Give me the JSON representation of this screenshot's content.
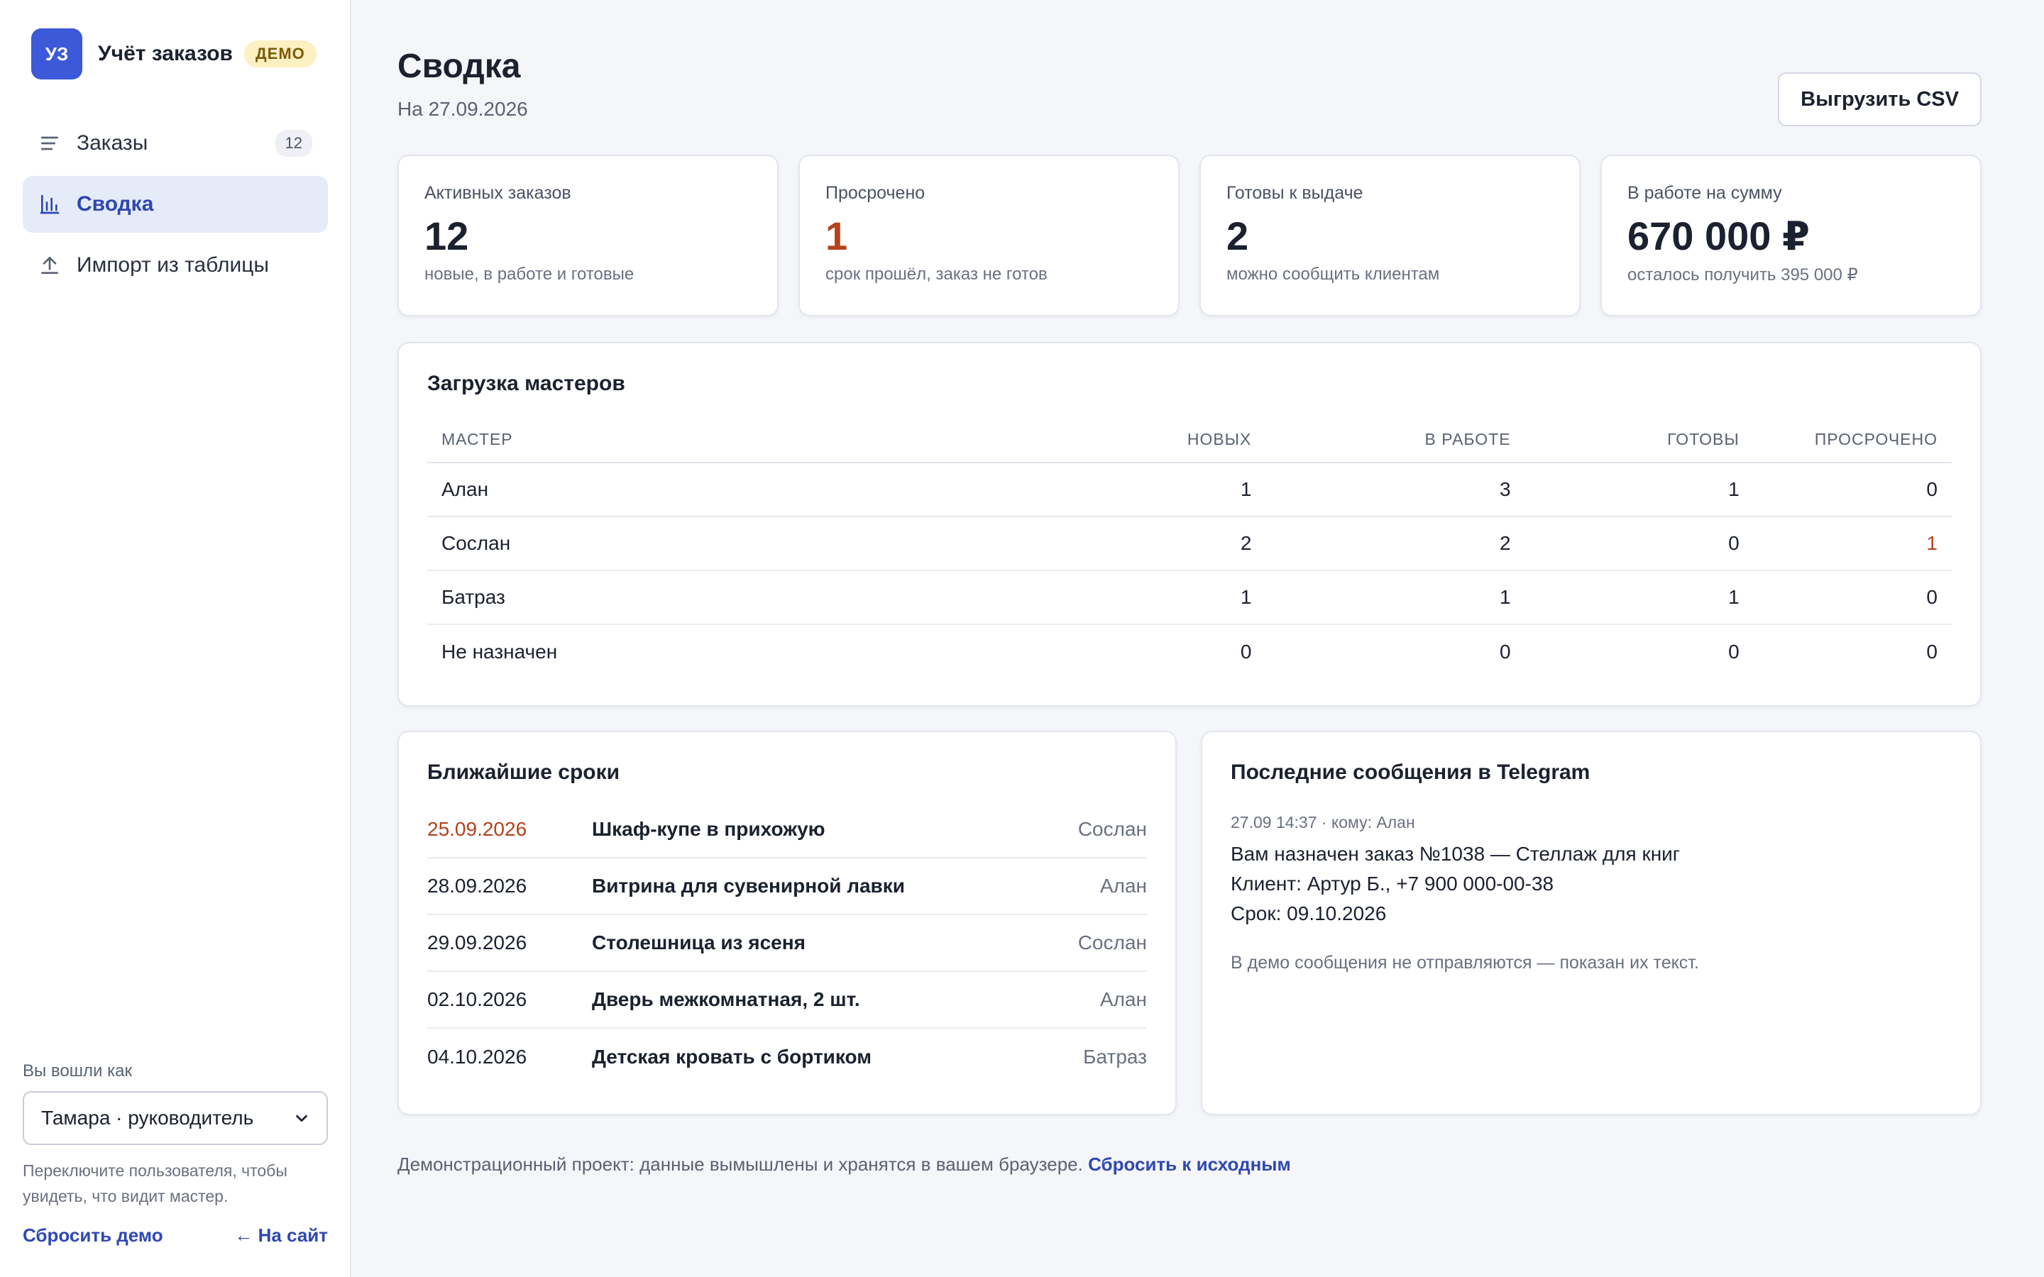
{
  "brand": {
    "logo": "УЗ",
    "name": "Учёт заказов",
    "badge": "ДЕМО"
  },
  "sidebar": {
    "items": [
      {
        "label": "Заказы",
        "icon": "list-icon",
        "count": "12"
      },
      {
        "label": "Сводка",
        "icon": "bar-chart-icon",
        "active": true
      },
      {
        "label": "Импорт из таблицы",
        "icon": "upload-icon"
      }
    ],
    "user_label": "Вы вошли как",
    "user_value": "Тамара · руководитель",
    "user_hint": "Переключите пользователя, чтобы увидеть, что видит мастер.",
    "reset_demo": "Сбросить демо",
    "to_site": "← На сайт"
  },
  "header": {
    "title": "Сводка",
    "date": "На 27.09.2026",
    "export_label": "Выгрузить CSV"
  },
  "stats": [
    {
      "label": "Активных заказов",
      "value": "12",
      "sub": "новые, в работе и готовые"
    },
    {
      "label": "Просрочено",
      "value": "1",
      "sub": "срок прошёл, заказ не готов",
      "warn": true
    },
    {
      "label": "Готовы к выдаче",
      "value": "2",
      "sub": "можно сообщить клиентам"
    },
    {
      "label": "В работе на сумму",
      "value": "670 000 ₽",
      "sub": "осталось получить 395 000 ₽"
    }
  ],
  "masters": {
    "title": "Загрузка мастеров",
    "columns": [
      "МАСТЕР",
      "НОВЫХ",
      "В РАБОТЕ",
      "ГОТОВЫ",
      "ПРОСРОЧЕНО"
    ],
    "rows": [
      [
        "Алан",
        "1",
        "3",
        "1",
        "0"
      ],
      [
        "Сослан",
        "2",
        "2",
        "0",
        "1"
      ],
      [
        "Батраз",
        "1",
        "1",
        "1",
        "0"
      ],
      [
        "Не назначен",
        "0",
        "0",
        "0",
        "0"
      ]
    ]
  },
  "deadlines": {
    "title": "Ближайшие сроки",
    "items": [
      {
        "date": "25.09.2026",
        "name": "Шкаф-купе в прихожую",
        "master": "Сослан",
        "overdue": true
      },
      {
        "date": "28.09.2026",
        "name": "Витрина для сувенирной лавки",
        "master": "Алан"
      },
      {
        "date": "29.09.2026",
        "name": "Столешница из ясеня",
        "master": "Сослан"
      },
      {
        "date": "02.10.2026",
        "name": "Дверь межкомнатная, 2 шт.",
        "master": "Алан"
      },
      {
        "date": "04.10.2026",
        "name": "Детская кровать с бортиком",
        "master": "Батраз"
      }
    ]
  },
  "telegram": {
    "title": "Последние сообщения в Telegram",
    "meta": "27.09 14:37 · кому: Алан",
    "lines": [
      "Вам назначен заказ №1038 — Стеллаж для книг",
      "Клиент: Артур Б., +7 900 000-00-38",
      "Срок: 09.10.2026"
    ],
    "note": "В демо сообщения не отправляются — показан их текст."
  },
  "footer": {
    "text": "Демонстрационный проект: данные вымышлены и хранятся в вашем браузере.",
    "link": "Сбросить к исходным"
  },
  "colors": {
    "accent": "#3c59d9",
    "warn": "#b5421b",
    "badge_bg": "#fdf0c2"
  }
}
